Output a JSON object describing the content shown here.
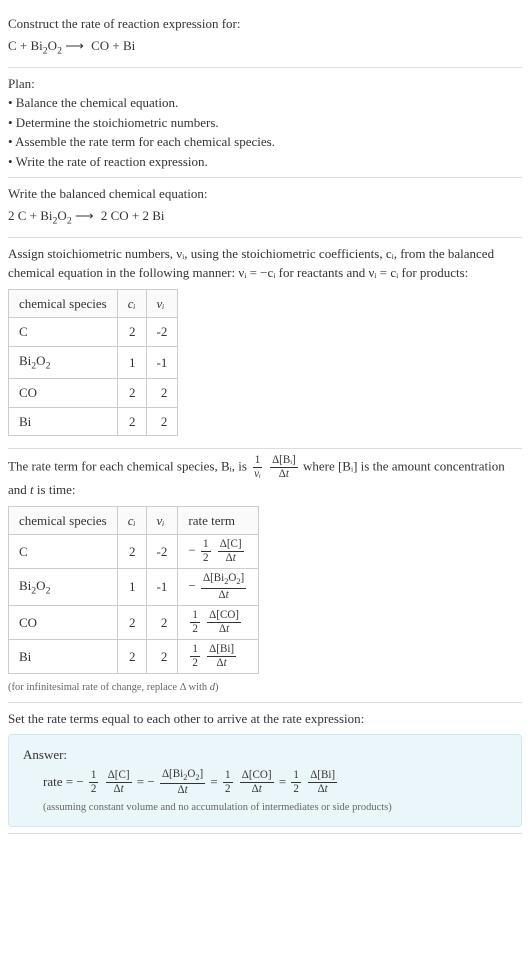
{
  "intro": {
    "prompt": "Construct the rate of reaction expression for:",
    "equation_lhs": "C + Bi",
    "equation_rhs": "CO + Bi",
    "o2_sub": "2",
    "sub2": "2"
  },
  "plan": {
    "heading": "Plan:",
    "items": [
      "• Balance the chemical equation.",
      "• Determine the stoichiometric numbers.",
      "• Assemble the rate term for each chemical species.",
      "• Write the rate of reaction expression."
    ]
  },
  "balanced": {
    "heading": "Write the balanced chemical equation:",
    "lhs_prefix": "2 C + Bi",
    "rhs": "2 CO + 2 Bi",
    "sub2": "2",
    "o2": "O"
  },
  "stoich": {
    "text": "Assign stoichiometric numbers, νᵢ, using the stoichiometric coefficients, cᵢ, from the balanced chemical equation in the following manner: νᵢ = −cᵢ for reactants and νᵢ = cᵢ for products:",
    "headers": [
      "chemical species",
      "cᵢ",
      "νᵢ"
    ],
    "rows": [
      {
        "species_html": "C",
        "c": "2",
        "v": "-2"
      },
      {
        "species_html": "Bi₂O₂",
        "c": "1",
        "v": "-1"
      },
      {
        "species_html": "CO",
        "c": "2",
        "v": "2"
      },
      {
        "species_html": "Bi",
        "c": "2",
        "v": "2"
      }
    ]
  },
  "rate_term": {
    "text_before": "The rate term for each chemical species, Bᵢ, is ",
    "text_after": " where [Bᵢ] is the amount concentration and t is time:",
    "frac1_num": "1",
    "frac1_den": "νᵢ",
    "frac2_num": "Δ[Bᵢ]",
    "frac2_den": "Δt",
    "headers": [
      "chemical species",
      "cᵢ",
      "νᵢ",
      "rate term"
    ],
    "rows": [
      {
        "species": "C",
        "c": "2",
        "v": "-2",
        "sign": "−",
        "f1n": "1",
        "f1d": "2",
        "f2n": "Δ[C]",
        "f2d": "Δt"
      },
      {
        "species": "Bi₂O₂",
        "c": "1",
        "v": "-1",
        "sign": "−",
        "f1n": "",
        "f1d": "",
        "f2n": "Δ[Bi₂O₂]",
        "f2d": "Δt"
      },
      {
        "species": "CO",
        "c": "2",
        "v": "2",
        "sign": "",
        "f1n": "1",
        "f1d": "2",
        "f2n": "Δ[CO]",
        "f2d": "Δt"
      },
      {
        "species": "Bi",
        "c": "2",
        "v": "2",
        "sign": "",
        "f1n": "1",
        "f1d": "2",
        "f2n": "Δ[Bi]",
        "f2d": "Δt"
      }
    ],
    "note": "(for infinitesimal rate of change, replace Δ with d)"
  },
  "final": {
    "heading": "Set the rate terms equal to each other to arrive at the rate expression:"
  },
  "answer": {
    "label": "Answer:",
    "prefix": "rate = −",
    "half_n": "1",
    "half_d": "2",
    "t1n": "Δ[C]",
    "t1d": "Δt",
    "eq1": " = −",
    "t2n": "Δ[Bi₂O₂]",
    "t2d": "Δt",
    "eq2": " = ",
    "t3n": "Δ[CO]",
    "t3d": "Δt",
    "eq3": " = ",
    "t4n": "Δ[Bi]",
    "t4d": "Δt",
    "note": "(assuming constant volume and no accumulation of intermediates or side products)"
  }
}
